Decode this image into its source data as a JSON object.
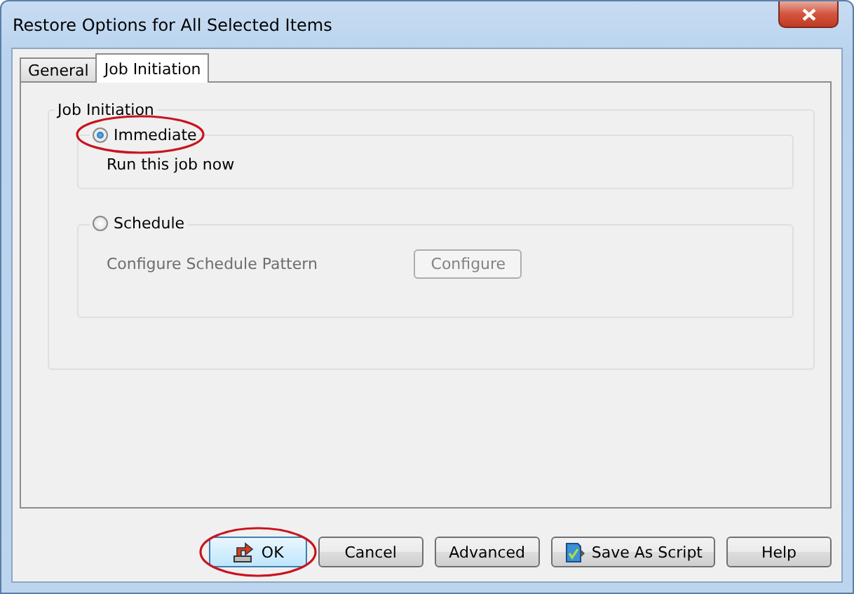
{
  "window": {
    "title": "Restore Options for All Selected Items"
  },
  "tabs": [
    {
      "label": "General",
      "selected": false
    },
    {
      "label": "Job Initiation",
      "selected": true
    }
  ],
  "group": {
    "title": "Job Initiation",
    "options": [
      {
        "label": "Immediate",
        "selected": true,
        "highlighted": true,
        "disabled": false,
        "text": "Run this job now"
      },
      {
        "label": "Schedule",
        "selected": false,
        "highlighted": false,
        "disabled": true,
        "text": "Configure Schedule Pattern",
        "button": "Configure"
      }
    ]
  },
  "buttons": [
    {
      "label": "OK",
      "kind": "restore",
      "highlighted": true
    },
    {
      "label": "Cancel",
      "kind": "plain",
      "highlighted": false
    },
    {
      "label": "Advanced",
      "kind": "plain",
      "highlighted": false
    },
    {
      "label": "Save As Script",
      "kind": "script",
      "highlighted": false
    },
    {
      "label": "Help",
      "kind": "plain",
      "highlighted": false
    }
  ]
}
